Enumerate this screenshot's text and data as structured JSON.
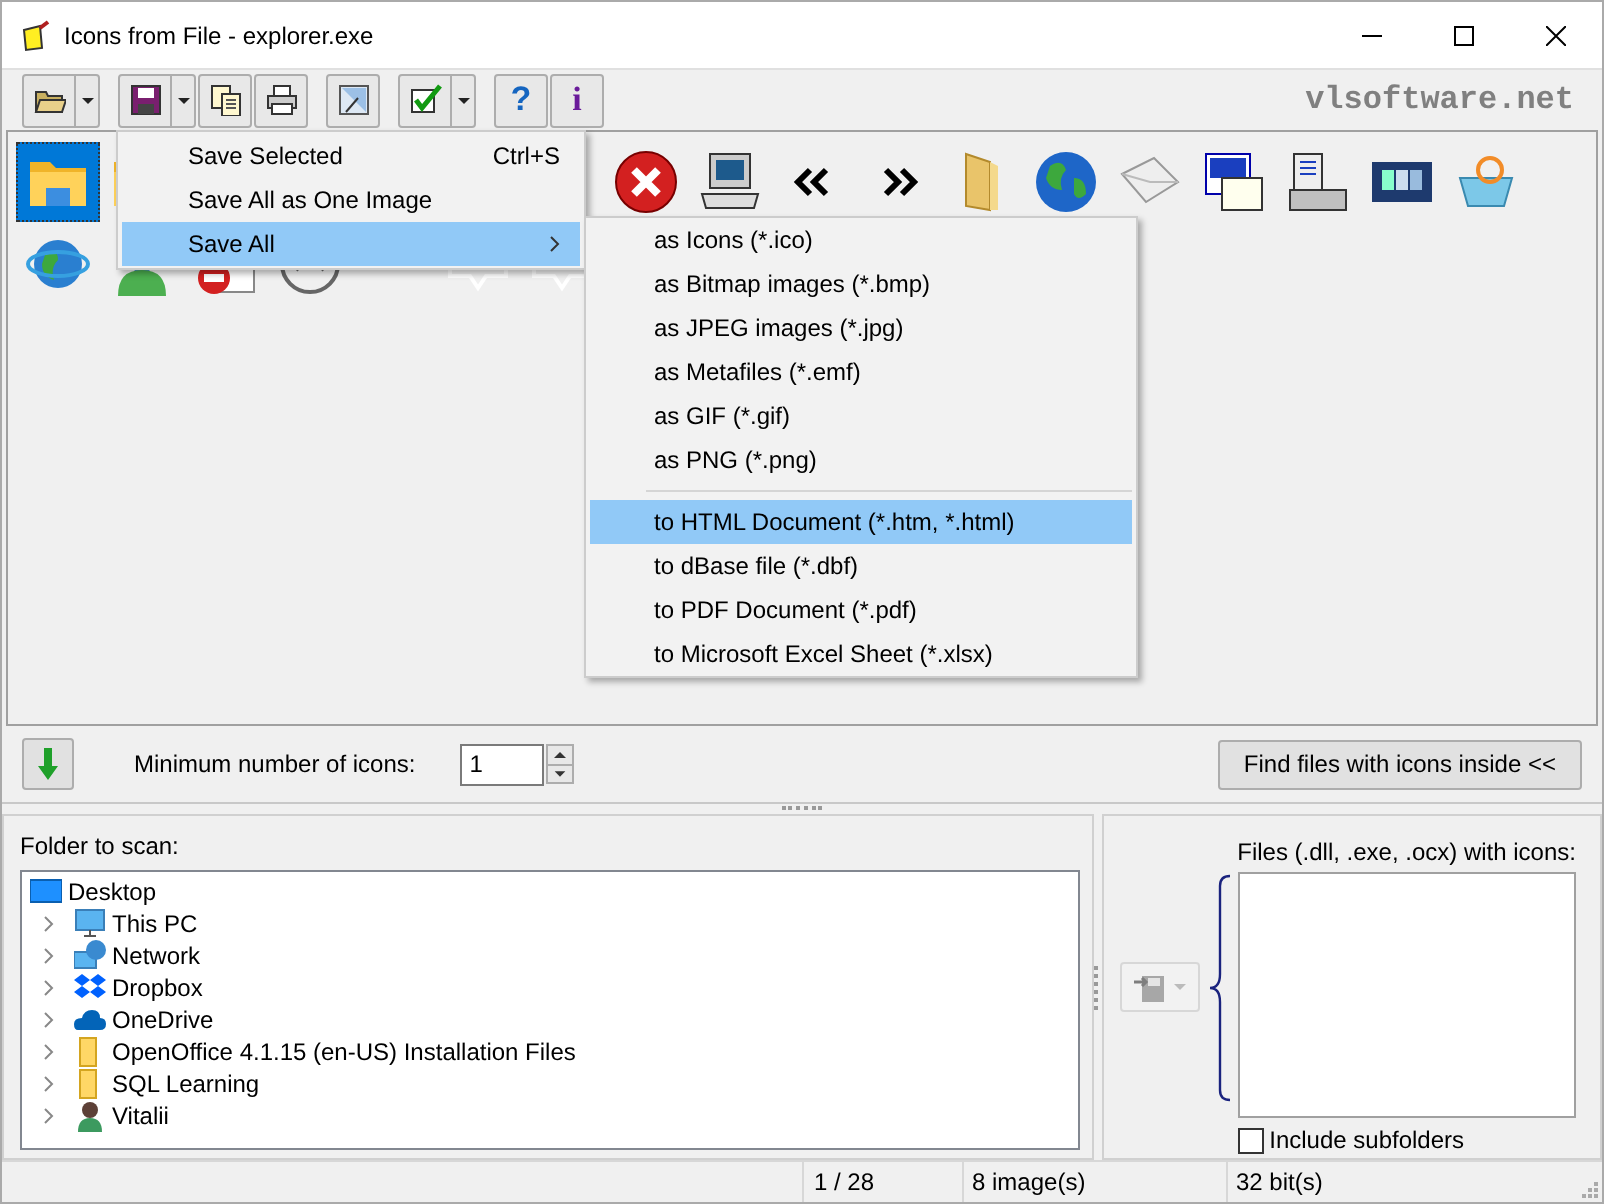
{
  "window": {
    "title": "Icons from File - explorer.exe"
  },
  "toolbar": {
    "buttons": [
      {
        "kind": "open",
        "dropdown": true
      },
      {
        "kind": "save",
        "dropdown": true
      },
      {
        "kind": "copy",
        "dropdown": false
      },
      {
        "kind": "print",
        "dropdown": false
      },
      {
        "kind": "image",
        "dropdown": false
      },
      {
        "kind": "check",
        "dropdown": true
      },
      {
        "kind": "text",
        "label": "?",
        "dropdown": false
      },
      {
        "kind": "text",
        "label": "i",
        "dropdown": false
      }
    ],
    "site": "vlsoftware.net"
  },
  "icon_grid": {
    "rows": [
      [
        {
          "kind": "folder",
          "selected": true
        },
        {
          "kind": "folder",
          "selected": false
        },
        null,
        null,
        null,
        null,
        null,
        {
          "kind": "error",
          "selected": false
        },
        {
          "kind": "computer",
          "selected": false
        },
        {
          "kind": "chevrons-left",
          "selected": false
        },
        {
          "kind": "chevrons-right",
          "selected": false
        },
        {
          "kind": "folder-tall",
          "selected": false
        },
        {
          "kind": "globe",
          "selected": false
        },
        {
          "kind": "envelope",
          "selected": false
        },
        {
          "kind": "document",
          "selected": false
        },
        {
          "kind": "tower",
          "selected": false
        },
        {
          "kind": "screen",
          "selected": false
        },
        {
          "kind": "basket",
          "selected": false
        }
      ],
      [
        {
          "kind": "globe-ring",
          "selected": false
        },
        {
          "kind": "user",
          "selected": false
        },
        {
          "kind": "no-entry",
          "selected": false
        },
        {
          "kind": "circle-up",
          "selected": false
        },
        null,
        {
          "kind": "bubble",
          "selected": false
        },
        {
          "kind": "bubble",
          "selected": false
        }
      ]
    ]
  },
  "save_menu": {
    "items": [
      {
        "kind": "item",
        "label": "Save Selected",
        "shortcut": "Ctrl+S",
        "submenu": false,
        "selected": false
      },
      {
        "kind": "item",
        "label": "Save All as One Image",
        "submenu": false,
        "selected": false
      },
      {
        "kind": "item",
        "label": "Save All",
        "submenu": true,
        "selected": true
      }
    ]
  },
  "save_all_submenu": {
    "items": [
      {
        "kind": "item",
        "label": "as Icons (*.ico)",
        "selected": false
      },
      {
        "kind": "item",
        "label": "as Bitmap images (*.bmp)",
        "selected": false
      },
      {
        "kind": "item",
        "label": "as JPEG images (*.jpg)",
        "selected": false
      },
      {
        "kind": "item",
        "label": "as Metafiles (*.emf)",
        "selected": false
      },
      {
        "kind": "item",
        "label": "as GIF (*.gif)",
        "selected": false
      },
      {
        "kind": "item",
        "label": "as PNG (*.png)",
        "selected": false
      },
      {
        "kind": "separator"
      },
      {
        "kind": "item",
        "label": "to HTML Document (*.htm, *.html)",
        "selected": true
      },
      {
        "kind": "item",
        "label": "to dBase file (*.dbf)",
        "selected": false
      },
      {
        "kind": "item",
        "label": "to PDF Document (*.pdf)",
        "selected": false
      },
      {
        "kind": "item",
        "label": "to Microsoft Excel Sheet (*.xlsx)",
        "selected": false
      }
    ]
  },
  "options": {
    "min_icons_label": "Minimum number of icons:",
    "min_icons_value": "1",
    "find_button": "Find files with icons inside <<"
  },
  "folder_panel": {
    "label": "Folder to scan:",
    "tree": [
      {
        "label": "Desktop",
        "kind": "desktop",
        "children": [
          {
            "label": "This PC",
            "kind": "pc",
            "expanded": false
          },
          {
            "label": "Network",
            "kind": "network",
            "expanded": false
          },
          {
            "label": "Dropbox",
            "kind": "dropbox",
            "expanded": false
          },
          {
            "label": "OneDrive",
            "kind": "onedrive",
            "expanded": false
          },
          {
            "label": "OpenOffice 4.1.15 (en-US) Installation Files",
            "kind": "folder",
            "expanded": false
          },
          {
            "label": "SQL Learning",
            "kind": "folder",
            "expanded": false
          },
          {
            "label": "Vitalii",
            "kind": "user",
            "expanded": false
          }
        ]
      }
    ]
  },
  "files_panel": {
    "label": "Files (.dll, .exe, .ocx) with icons:",
    "add_button_disabled": true,
    "include_subfolders": {
      "label": "Include subfolders",
      "checked": false
    }
  },
  "status_bar": {
    "position": "1 / 28",
    "images": "8 image(s)",
    "bits": "32 bit(s)"
  }
}
